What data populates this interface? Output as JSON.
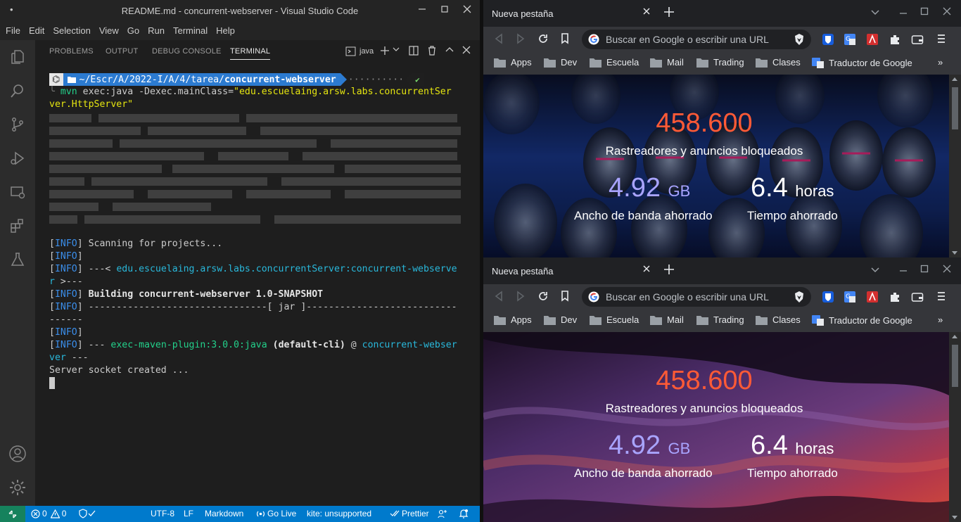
{
  "vscode": {
    "title": "README.md - concurrent-webserver - Visual Studio Code",
    "menu": [
      "File",
      "Edit",
      "Selection",
      "View",
      "Go",
      "Run",
      "Terminal",
      "Help"
    ],
    "panel_tabs": [
      "PROBLEMS",
      "OUTPUT",
      "DEBUG CONSOLE",
      "TERMINAL"
    ],
    "terminal_shell": "java",
    "terminal": {
      "prompt_path_prefix": "~/Escr/A/2022-I/A/4/tarea/",
      "prompt_path_bold": "concurrent-webserver",
      "prompt_dots": "··········",
      "prompt_check": "✔",
      "cmd_name": "mvn",
      "cmd_args": " exec:java -Dexec.mainClass=",
      "cmd_class_1": "\"edu.escuelaing.arsw.labs.concurrentSer",
      "cmd_class_2": "ver.HttpServer\"",
      "info_tag": "INFO",
      "line_scanning": " Scanning for projects...",
      "line_group_prefix": " ---< ",
      "line_group_name": "edu.escuelaing.arsw.labs.concurrentServer:concurrent-webserve",
      "line_group_wrap": "r",
      "line_group_suffix": " >---",
      "line_building": " Building concurrent-webserver 1.0-SNAPSHOT",
      "line_jar": " --------------------------------[ jar ]---------------------------",
      "line_jar_wrap": "------",
      "line_plugin_dashes": " --- ",
      "line_plugin_name": "exec-maven-plugin:3.0.0:java",
      "line_plugin_cli": " (default-cli)",
      "line_plugin_at": " @ ",
      "line_plugin_proj": "concurrent-webser",
      "line_plugin_wrap_1": "ver",
      "line_plugin_wrap_2": " ---",
      "line_server": "Server socket created ..."
    },
    "status": {
      "errors": "0",
      "warnings": "0",
      "encoding": "UTF-8",
      "eol": "LF",
      "language": "Markdown",
      "golive": "Go Live",
      "kite": "kite: unsupported",
      "prettier": "Prettier"
    }
  },
  "chrome": {
    "tab_title": "Nueva pestaña",
    "omnibox_placeholder": "Buscar en Google o escribir una URL",
    "bookmarks": [
      "Apps",
      "Dev",
      "Escuela",
      "Mail",
      "Trading",
      "Clases",
      "Traductor de Google"
    ],
    "stats": {
      "trackers_value": "458.600",
      "trackers_label": "Rastreadores y anuncios bloqueados",
      "bandwidth_value": "4.92",
      "bandwidth_unit": "GB",
      "bandwidth_label": "Ancho de banda ahorrado",
      "time_value": "6.4",
      "time_unit": "horas",
      "time_label": "Tiempo ahorrado"
    },
    "colors": {
      "accent_orange": "#ff5a36",
      "bandwidth_purple": "#a9a4ff"
    }
  }
}
